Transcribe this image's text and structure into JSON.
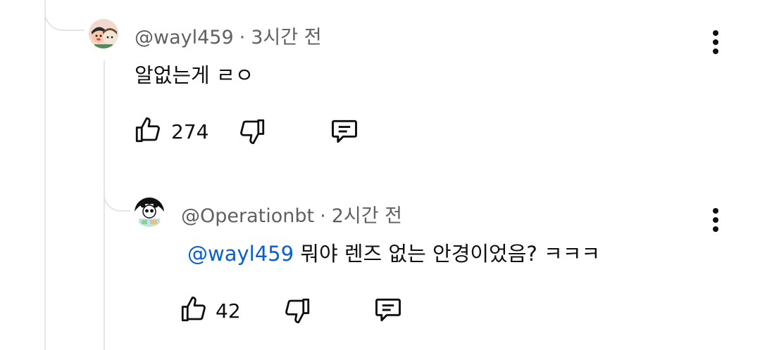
{
  "comments": [
    {
      "handle": "@wayl459",
      "time": "3시간 전",
      "text": "알없는게 ㄹㅇ",
      "likes": "274",
      "avatar_icon": "cartoon-avatar-icon"
    },
    {
      "handle": "@Operationbt",
      "time": "2시간 전",
      "mention": "@wayl459",
      "text": " 뭐야 렌즈 없는 안경이었음? ㅋㅋㅋ",
      "likes": "42",
      "avatar_icon": "panda-avatar-icon"
    }
  ],
  "separator": "·",
  "colors": {
    "text": "#0f0f0f",
    "meta": "#606060",
    "mention": "#065fd4",
    "thread_line": "#e5e5e5"
  }
}
